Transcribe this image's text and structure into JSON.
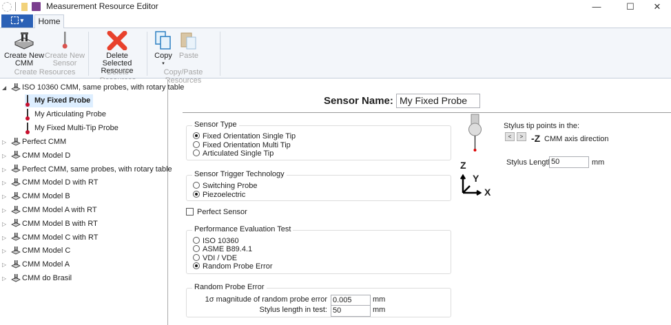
{
  "window": {
    "title": "Measurement Resource Editor",
    "minimize": "—",
    "maximize": "☐",
    "close": "✕"
  },
  "ribbon": {
    "app_menu": "▾",
    "tab_home": "Home",
    "create_cmm": [
      "Create New",
      "CMM"
    ],
    "create_sensor": [
      "Create New",
      "Sensor"
    ],
    "delete": [
      "Delete Selected",
      "Resource"
    ],
    "copy": "Copy",
    "copy_arrow": "▾",
    "paste": "Paste",
    "groups": {
      "create": "Create Resources",
      "delete": "Delete Resources",
      "copypaste": "Copy/Paste Resources"
    }
  },
  "tree": {
    "root": "ISO 10360 CMM, same probes, with rotary table",
    "children": [
      "My Fixed Probe",
      "My Articulating Probe",
      "My Fixed Multi-Tip Probe"
    ],
    "items": [
      "Perfect CMM",
      "CMM Model D",
      "Perfect CMM, same probes, with rotary table",
      "CMM Model D with RT",
      "CMM Model B",
      "CMM Model A with RT",
      "CMM Model B with RT",
      "CMM Model C with RT",
      "CMM Model C",
      "CMM Model A",
      "CMM do Brasil"
    ]
  },
  "editor": {
    "sensor_name_label": "Sensor Name:",
    "sensor_name": "My Fixed Probe",
    "sensor_type": {
      "label": "Sensor Type",
      "options": [
        "Fixed Orientation Single Tip",
        "Fixed Orientation Multi Tip",
        "Articulated Single Tip"
      ],
      "selected": 0
    },
    "trigger": {
      "label": "Sensor Trigger Technology",
      "options": [
        "Switching Probe",
        "Piezoelectric"
      ],
      "selected": 1
    },
    "perfect_sensor": {
      "label": "Perfect Sensor",
      "checked": false
    },
    "performance": {
      "label": "Performance Evaluation Test",
      "options": [
        "ISO 10360",
        "ASME B89.4.1",
        "VDI / VDE",
        "Random Probe Error"
      ],
      "selected": 3
    },
    "random": {
      "label": "Random Probe Error",
      "magnitude_label": "1σ magnitude of random probe error",
      "magnitude": "0.005",
      "unit1": "mm",
      "length_label": "Stylus length in test:",
      "length": "50",
      "unit2": "mm"
    },
    "stylus": {
      "tip_label": "Stylus tip points in the:",
      "prev": "<",
      "next": ">",
      "direction": "-Z",
      "direction_suffix": "CMM axis direction",
      "length_label": "Stylus Length:",
      "length": "50",
      "unit": "mm"
    },
    "axes": {
      "z": "Z",
      "y": "Y",
      "x": "X"
    }
  }
}
